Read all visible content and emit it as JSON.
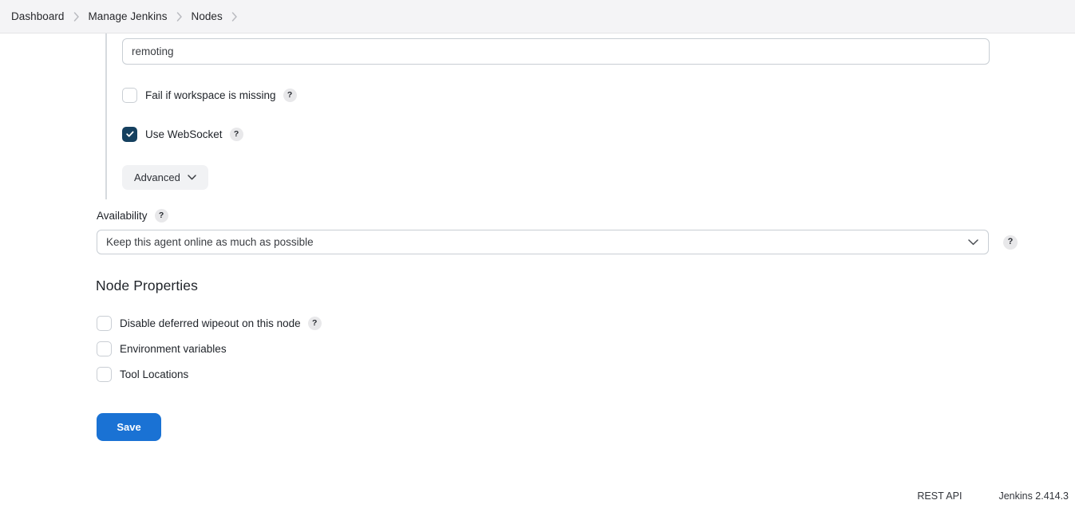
{
  "breadcrumb": {
    "items": [
      {
        "label": "Dashboard"
      },
      {
        "label": "Manage Jenkins"
      },
      {
        "label": "Nodes"
      }
    ],
    "separator_icon": "chevron-right-icon",
    "trailing_separator": true
  },
  "form": {
    "remoting_input": {
      "value": "remoting",
      "placeholder": ""
    },
    "checkboxes": [
      {
        "label": "Fail if workspace is missing",
        "checked": false,
        "has_help": true,
        "help_label": "?"
      },
      {
        "label": "Use WebSocket",
        "checked": true,
        "has_help": true,
        "help_label": "?"
      }
    ],
    "advanced_button": {
      "label": "Advanced",
      "icon": "chevron-down-icon"
    }
  },
  "availability": {
    "label": "Availability",
    "help_label": "?",
    "selected_option": "Keep this agent online as much as possible",
    "chevron_icon": "chevron-down-icon",
    "trailing_help_label": "?"
  },
  "node_properties": {
    "title": "Node Properties",
    "items": [
      {
        "label": "Disable deferred wipeout on this node",
        "checked": false,
        "has_help": true,
        "help_label": "?"
      },
      {
        "label": "Environment variables",
        "checked": false,
        "has_help": false
      },
      {
        "label": "Tool Locations",
        "checked": false,
        "has_help": false
      }
    ]
  },
  "actions": {
    "save_label": "Save"
  },
  "footer": {
    "rest_api_label": "REST API",
    "version_label": "Jenkins 2.414.3"
  },
  "colors": {
    "accent_blue": "#1a72d4",
    "checkbox_checked": "#15405f",
    "header_bg": "#f4f4f6",
    "border": "#c8ced4"
  }
}
